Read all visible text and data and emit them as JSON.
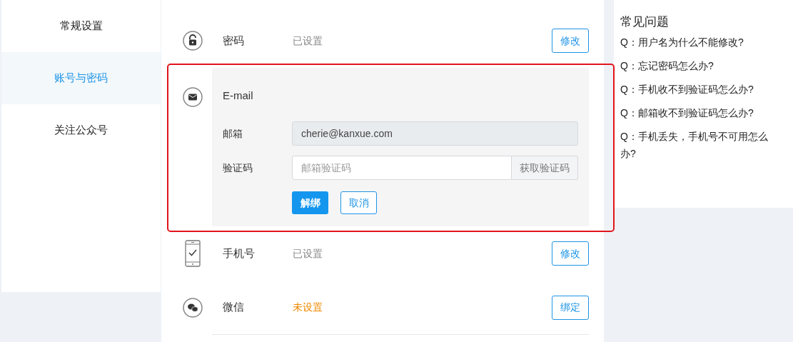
{
  "sidebar": {
    "items": [
      {
        "label": "常规设置",
        "selected": false
      },
      {
        "label": "账号与密码",
        "selected": true
      },
      {
        "label": "关注公众号",
        "selected": false
      }
    ]
  },
  "security_items": [
    {
      "kind": "row",
      "label": "密码",
      "status": "已设置",
      "is_set": true,
      "action": "修改",
      "highlighted": false
    },
    {
      "kind": "expanded",
      "label": "E-mail",
      "highlighted": true,
      "fields": [
        {
          "kind": "readonly",
          "label": "邮箱",
          "value": "cherie@kanxue.com"
        },
        {
          "kind": "code",
          "label": "验证码",
          "placeholder": "邮箱验证码",
          "addon": "获取验证码"
        }
      ],
      "buttons": [
        {
          "label": "解绑",
          "kind": "primary"
        },
        {
          "label": "取消",
          "kind": "secondary"
        }
      ]
    },
    {
      "kind": "row",
      "label": "手机号",
      "status": "已设置",
      "is_set": true,
      "action": "修改",
      "highlighted": false
    },
    {
      "kind": "row",
      "label": "微信",
      "status": "未设置",
      "is_set": false,
      "action": "绑定",
      "highlighted": false
    }
  ],
  "faq": {
    "title": "常见问题",
    "questions": [
      "Q：用户名为什么不能修改?",
      "Q：忘记密码怎么办?",
      "Q：手机收不到验证码怎么办?",
      "Q：邮箱收不到验证码怎么办?",
      "Q：手机丢失，手机号不可用怎么办?"
    ]
  }
}
